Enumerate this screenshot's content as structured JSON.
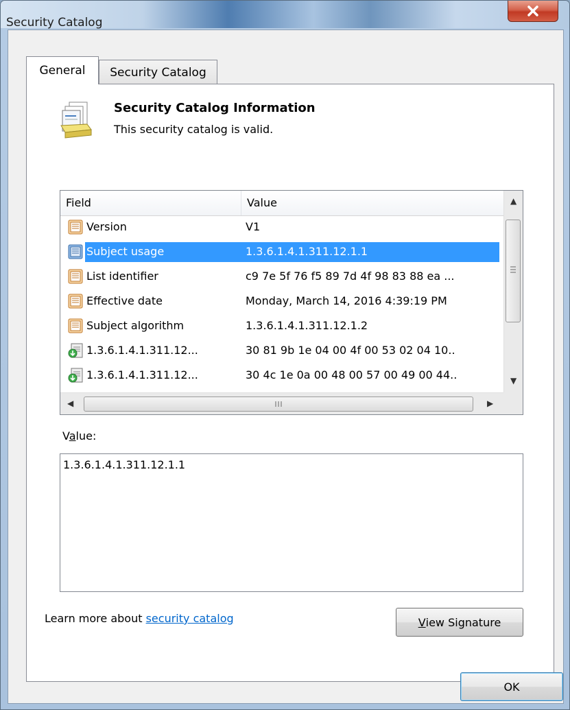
{
  "window": {
    "title": "Security Catalog"
  },
  "tabs": [
    {
      "label": "General",
      "active": true
    },
    {
      "label": "Security Catalog",
      "active": false
    }
  ],
  "info": {
    "title": "Security Catalog Information",
    "subtitle": "This security catalog is valid.",
    "icon": "catalog-document-icon"
  },
  "list": {
    "columns": {
      "field": "Field",
      "value": "Value"
    },
    "rows": [
      {
        "field": "Version",
        "value": "V1",
        "icon": "property-icon"
      },
      {
        "field": "Subject usage",
        "value": "1.3.6.1.4.1.311.12.1.1",
        "icon": "property-icon",
        "selected": true
      },
      {
        "field": "List identifier",
        "value": "c9 7e 5f 76 f5 89 7d 4f 98 83 88 ea ...",
        "icon": "property-icon"
      },
      {
        "field": "Effective date",
        "value": "Monday, March 14, 2016 4:39:19 PM",
        "icon": "property-icon"
      },
      {
        "field": "Subject algorithm",
        "value": "1.3.6.1.4.1.311.12.1.2",
        "icon": "property-icon"
      },
      {
        "field": "1.3.6.1.4.1.311.12...",
        "value": "30 81 9b 1e 04 00 4f 00 53 02 04 10..",
        "icon": "extension-icon"
      },
      {
        "field": "1.3.6.1.4.1.311.12...",
        "value": "30 4c 1e 0a 00 48 00 57 00 49 00 44..",
        "icon": "extension-icon"
      }
    ]
  },
  "value_section": {
    "label_prefix": "V",
    "label_accel": "a",
    "label_suffix": "lue:",
    "text": "1.3.6.1.4.1.311.12.1.1"
  },
  "footer": {
    "learn_prefix": "Learn more about ",
    "learn_link": "security catalog",
    "view_signature_accel": "V",
    "view_signature_rest": "iew Signature",
    "ok_label": "OK"
  },
  "colors": {
    "selection": "#3399ff",
    "link": "#0066cc",
    "close_button": "#c13a24"
  }
}
